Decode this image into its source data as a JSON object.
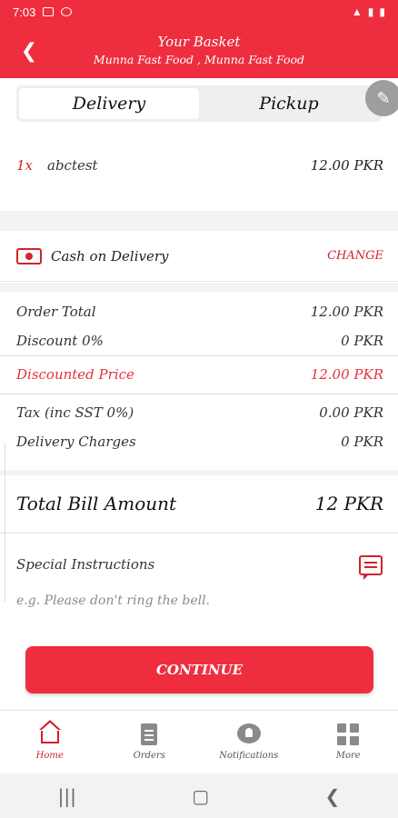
{
  "status_bar": {
    "time": "7:03"
  },
  "header": {
    "title": "Your Basket",
    "subtitle": "Munna Fast Food , Munna Fast Food"
  },
  "toggle": {
    "options": [
      "Delivery",
      "Pickup"
    ],
    "selected": "Delivery"
  },
  "items": [
    {
      "qty": "1x",
      "name": "abctest",
      "price": "12.00 PKR"
    }
  ],
  "payment": {
    "method": "Cash on Delivery",
    "change_label": "CHANGE"
  },
  "summary": {
    "order_total_label": "Order Total",
    "order_total_value": "12.00 PKR",
    "discount_label": "Discount 0%",
    "discount_value": "0 PKR",
    "discounted_price_label": "Discounted Price",
    "discounted_price_value": "12.00 PKR",
    "tax_label": "Tax (inc SST 0%)",
    "tax_value": "0.00 PKR",
    "delivery_label": "Delivery Charges",
    "delivery_value": "0 PKR"
  },
  "total": {
    "label": "Total Bill Amount",
    "value": "12 PKR"
  },
  "instructions": {
    "label": "Special Instructions",
    "placeholder": "e.g. Please don't ring the bell."
  },
  "continue_label": "CONTINUE",
  "bottom_nav": {
    "items": [
      {
        "label": "Home",
        "icon": "home-icon",
        "active": true
      },
      {
        "label": "Orders",
        "icon": "clipboard-icon",
        "active": false
      },
      {
        "label": "Notifications",
        "icon": "bell-icon",
        "active": false
      },
      {
        "label": "More",
        "icon": "grid-icon",
        "active": false
      }
    ]
  },
  "colors": {
    "accent": "#ee2e3f",
    "accent_text": "#d2232a"
  }
}
